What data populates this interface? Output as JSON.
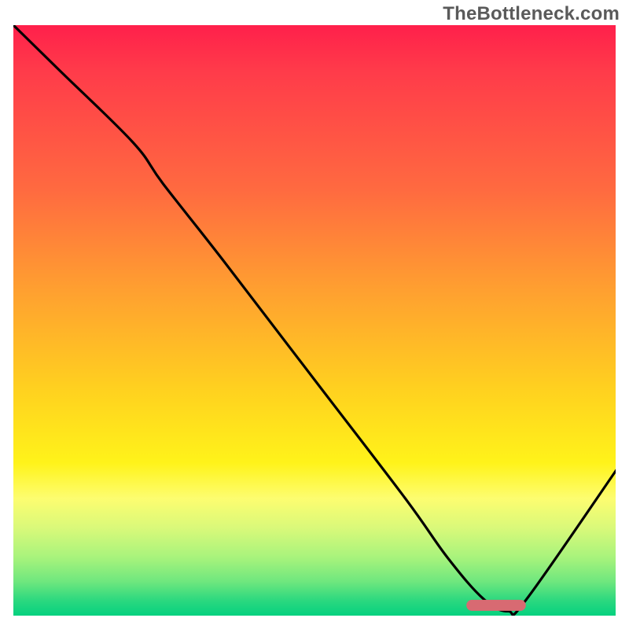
{
  "watermark": "TheBottleneck.com",
  "chart_data": {
    "type": "line",
    "title": "",
    "xlabel": "",
    "ylabel": "",
    "xlim": [
      0,
      100
    ],
    "ylim": [
      0,
      100
    ],
    "grid": false,
    "legend": false,
    "background": "red-to-green vertical gradient (high = red/bad, low = green/good)",
    "series": [
      {
        "name": "bottleneck-curve",
        "x": [
          0,
          8,
          20,
          25,
          35,
          50,
          65,
          72,
          78,
          82,
          85,
          100
        ],
        "values": [
          100,
          92,
          80,
          73,
          60,
          40,
          20,
          10,
          3,
          1,
          3,
          25
        ],
        "note": "Values read from vertical position against gradient; 100 = top (worst), 0 = bottom (best). Curve descends steeply, flattens near x≈78–82 at the minimum, then rises."
      }
    ],
    "annotations": [
      {
        "name": "optimal-range-marker",
        "x_start": 76,
        "x_end": 84,
        "y": 2,
        "color": "#d86a72",
        "shape": "rounded-bar",
        "meaning": "highlighted best / minimum-bottleneck range"
      }
    ],
    "gradient_stops": [
      {
        "pos": 0,
        "color": "#ff1f4b"
      },
      {
        "pos": 28,
        "color": "#ff6a40"
      },
      {
        "pos": 62,
        "color": "#ffd21f"
      },
      {
        "pos": 80,
        "color": "#fdfd70"
      },
      {
        "pos": 94,
        "color": "#6fe77e"
      },
      {
        "pos": 100,
        "color": "#00d07f"
      }
    ]
  }
}
